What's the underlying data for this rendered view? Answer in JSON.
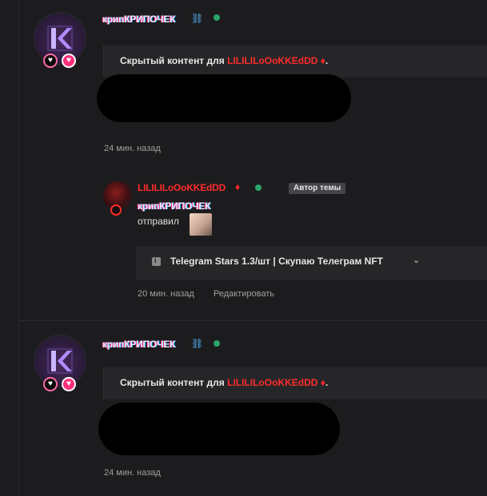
{
  "posts": [
    {
      "username": "крипКРИПОЧЕК",
      "verified_icon": "link-glyph",
      "hidden_prefix": "Скрытый контент для",
      "hidden_user": "LILILILoOoKKEdDD",
      "hidden_suffix": ".",
      "time": "24 мин. назад"
    },
    {
      "username": "крипКРИПОЧЕК",
      "verified_icon": "link-glyph",
      "hidden_prefix": "Скрытый контент для",
      "hidden_user": "LILILILoOoKKEdDD",
      "hidden_suffix": ".",
      "time": "24 мин. назад"
    }
  ],
  "reply": {
    "username": "LILILILoOoKKEdDD",
    "author_badge": "Автор темы",
    "mention": "крипКРИПОЧЕК",
    "message": "отправил",
    "link_title": "Telegram Stars 1.3/шт | Скупаю Телеграм NFT",
    "time": "20 мин. назад",
    "edit": "Редактировать"
  },
  "colors": {
    "background": "#1c1c1e",
    "card": "#262628",
    "red_name": "#ff2b2b",
    "online": "#2aa56c",
    "badge_pink": "#ff2f7b"
  },
  "icons": {
    "online": "green-dot",
    "badges": [
      "heart-badge-icon",
      "heart-badge-icon"
    ],
    "info": "info-icon",
    "chevron": "chevron-down-icon",
    "ring": "ring-icon"
  }
}
